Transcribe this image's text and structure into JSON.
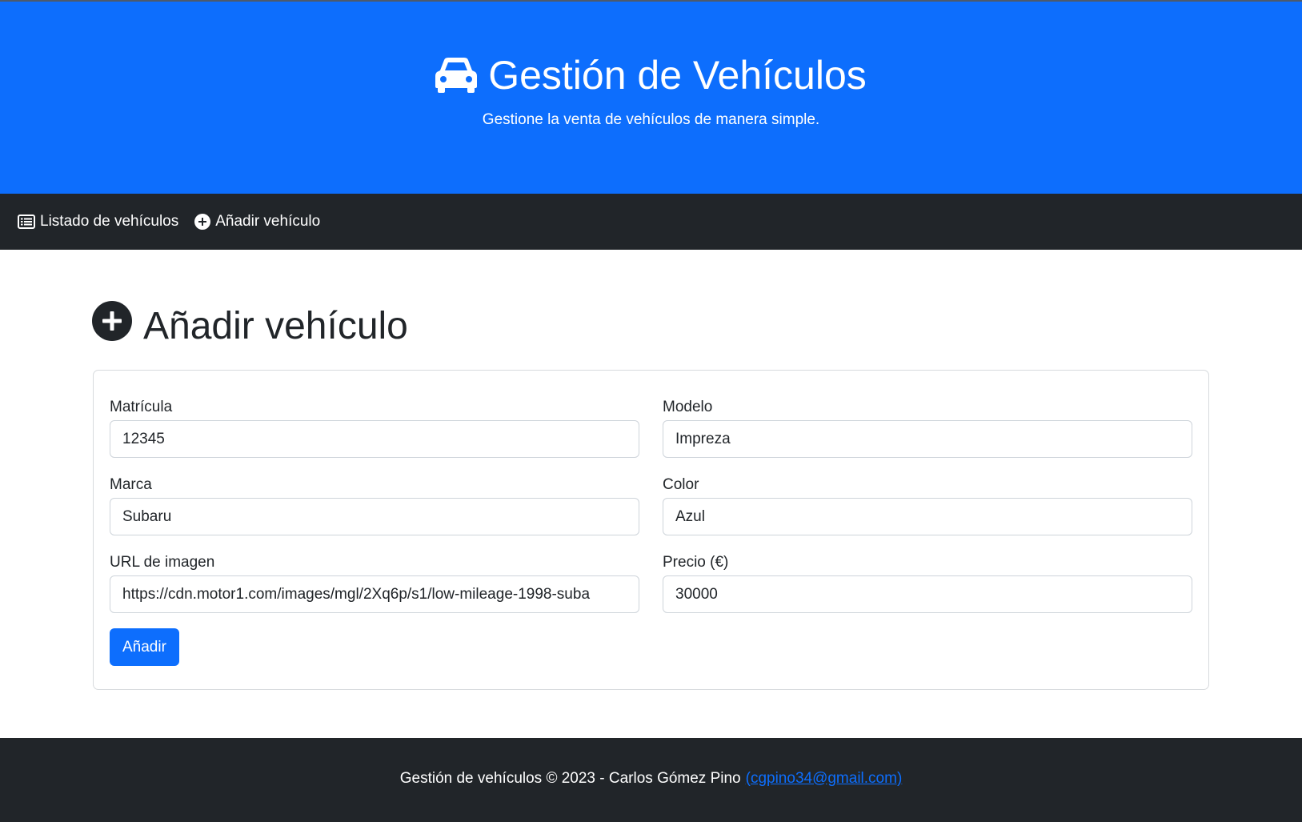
{
  "header": {
    "icon": "car-icon",
    "title": "Gestión de Vehículos",
    "subtitle": "Gestione la venta de vehículos de manera simple."
  },
  "nav": {
    "items": [
      {
        "icon": "list-icon",
        "label": "Listado de vehículos"
      },
      {
        "icon": "plus-circle-icon",
        "label": "Añadir vehículo"
      }
    ]
  },
  "main": {
    "icon": "plus-circle-icon",
    "heading": "Añadir vehículo"
  },
  "form": {
    "fields": {
      "matricula": {
        "label": "Matrícula",
        "value": "12345"
      },
      "modelo": {
        "label": "Modelo",
        "value": "Impreza"
      },
      "marca": {
        "label": "Marca",
        "value": "Subaru"
      },
      "color": {
        "label": "Color",
        "value": "Azul"
      },
      "url": {
        "label": "URL de imagen",
        "value": "https://cdn.motor1.com/images/mgl/2Xq6p/s1/low-mileage-1998-suba"
      },
      "precio": {
        "label": "Precio (€)",
        "value": "30000"
      }
    },
    "submit_label": "Añadir"
  },
  "footer": {
    "text": "Gestión de vehículos © 2023 - Carlos Gómez Pino",
    "email_link": "(cgpino34@gmail.com)"
  },
  "colors": {
    "primary": "#0d6efd",
    "dark": "#212529"
  }
}
